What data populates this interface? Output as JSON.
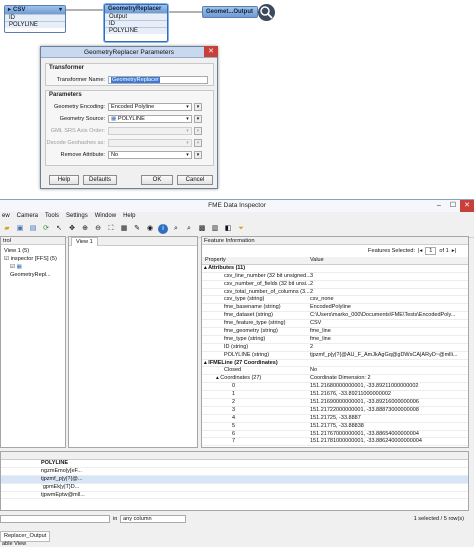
{
  "workspace": {
    "csv_node": {
      "title": "CSV",
      "ports": [
        "ID",
        "POLYLINE"
      ]
    },
    "replacer_node": {
      "title": "GeometryReplacer",
      "ports": [
        "Output",
        "ID",
        "POLYLINE"
      ]
    },
    "output_node": {
      "title": "Geomet...Output"
    }
  },
  "dialog": {
    "title": "GeometryReplacer Parameters",
    "transformer_group": "Transformer",
    "transformer_name_label": "Transformer Name:",
    "transformer_name_value": "GeometryReplacer",
    "parameters_group": "Parameters",
    "geometry_encoding_label": "Geometry Encoding:",
    "geometry_encoding_value": "Encoded Polyline",
    "geometry_source_label": "Geometry Source:",
    "geometry_source_value": "POLYLINE",
    "gml_srs_label": "GML SRS Axis Order:",
    "decode_geohashes_label": "Decode Geohashes as:",
    "remove_attribute_label": "Remove Attribute:",
    "remove_attribute_value": "No",
    "help": "Help",
    "defaults": "Defaults",
    "ok": "OK",
    "cancel": "Cancel"
  },
  "inspector": {
    "title": "FME Data Inspector",
    "menu": [
      "ew",
      "Camera",
      "Tools",
      "Settings",
      "Window",
      "Help"
    ],
    "left_header": "trol",
    "tree": [
      "View 1 (5)",
      "inspector [FFS] (5)",
      "GeometryRepl..."
    ],
    "view_tab": "View 1",
    "feature_info_title": "Feature Information",
    "features_selected_label": "Features Selected:",
    "feature_index": "1",
    "feature_total": "of 1",
    "col_property": "Property",
    "col_value": "Value",
    "rows": [
      [
        "▴ Attributes (11)",
        ""
      ],
      [
        "csv_line_number (32 bit unsigned...",
        "3"
      ],
      [
        "csv_number_of_fields (32 bit unsi...",
        "2"
      ],
      [
        "csv_total_number_of_columns (3...",
        "2"
      ],
      [
        "csv_type (string)",
        "csv_none"
      ],
      [
        "fme_basename (string)",
        "EncodedPolyline"
      ],
      [
        "fme_dataset (string)",
        "C:\\Users\\marko_000\\Documents\\FME\\Tests\\EncodedPoly..."
      ],
      [
        "fme_feature_type (string)",
        "CSV"
      ],
      [
        "fme_geometry (string)",
        "fme_line"
      ],
      [
        "fme_type (string)",
        "fme_line"
      ],
      [
        "ID (string)",
        "2"
      ],
      [
        "POLYLINE (string)",
        "tjpzmf_p|y|?{@AU_F_AmJkAgGq@gDWsCA|ARyD~@mlli..."
      ],
      [
        "▴ IFMELine (27 Coordinates)",
        ""
      ],
      [
        "Closed",
        "No"
      ],
      [
        "▴ Coordinates (27)",
        "Coordinate Dimension: 2"
      ],
      [
        "0",
        "151.21680000000001, -33.89211000000002"
      ],
      [
        "1",
        "151.21676, -33.89211000000002"
      ],
      [
        "2",
        "151.21690000000001, -33.89216000000006"
      ],
      [
        "3",
        "151.21722000000001, -33.88873000000008"
      ],
      [
        "4",
        "151.21725, -33.8887"
      ],
      [
        "5",
        "151.21775, -33.88838"
      ],
      [
        "6",
        "151.21767000000001, -33.88654000000004"
      ],
      [
        "7",
        "151.21781000000001, -33.886240000000004"
      ]
    ],
    "table_col": "POLYLINE",
    "table_rows": [
      "ngzmEmo|y[eF...",
      "tjpzmf_p|y|?{@...",
      "`gpmEk|y|T}D...",
      "tjpwmEptw@mll..."
    ],
    "search_in": "in",
    "search_scope": "any column",
    "status_right": "1 selected / 5 row(s)",
    "bottom_tab": "Replacer_Output",
    "bottom_tab2": "able View"
  }
}
